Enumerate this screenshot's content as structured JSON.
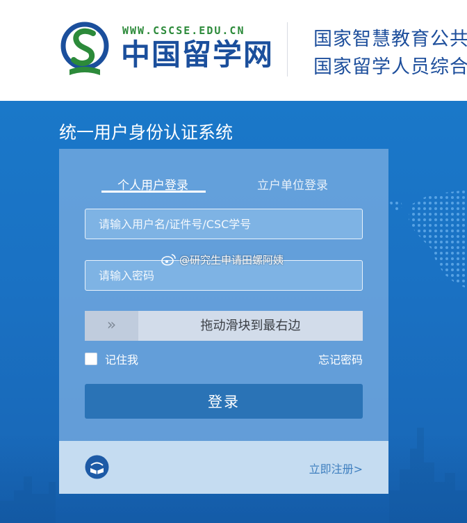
{
  "header": {
    "site_url": "WWW.CSCSE.EDU.CN",
    "site_name": "中国留学网",
    "line1": "国家智慧教育公共服务平台",
    "line2": "国家留学人员综合服务平台"
  },
  "main": {
    "system_title": "统一用户身份认证系统"
  },
  "login": {
    "tabs": [
      {
        "label": "个人用户登录",
        "active": true
      },
      {
        "label": "立户单位登录",
        "active": false
      }
    ],
    "username_placeholder": "请输入用户名/证件号/CSC学号",
    "password_placeholder": "请输入密码",
    "slider_handle_icon": "»",
    "slider_text": "拖动滑块到最右边",
    "remember_label": "记住我",
    "forgot_label": "忘记密码",
    "submit_label": "登录",
    "register_label": "立即注册>"
  },
  "watermark": {
    "text": "@研究生申请田螺阿姨"
  },
  "colors": {
    "brand_blue": "#1b4f9c",
    "brand_green": "#2c8a3a",
    "background_blue": "#1a78c9",
    "button_blue": "#2a73b6",
    "link_blue": "#3f7fbf"
  }
}
